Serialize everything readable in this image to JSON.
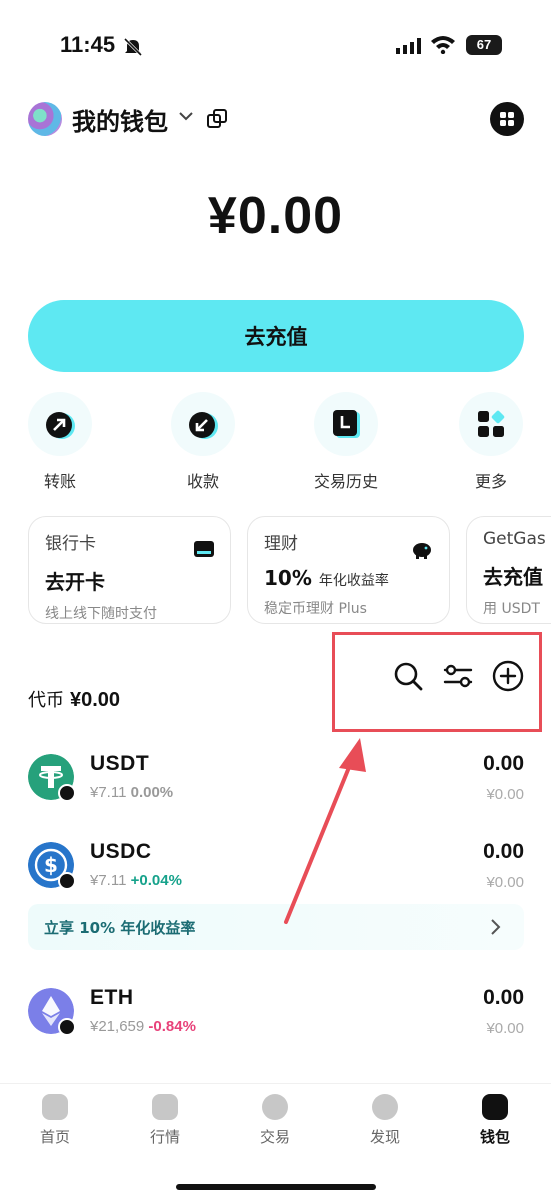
{
  "status_bar": {
    "time": "11:45",
    "battery": "67"
  },
  "header": {
    "wallet_name": "我的钱包"
  },
  "balance": "¥0.00",
  "recharge_label": "去充值",
  "actions": [
    {
      "label": "转账",
      "icon": "send-arrow-icon"
    },
    {
      "label": "收款",
      "icon": "receive-arrow-icon"
    },
    {
      "label": "交易历史",
      "icon": "history-icon"
    },
    {
      "label": "更多",
      "icon": "more-apps-icon"
    }
  ],
  "cards": [
    {
      "title": "银行卡",
      "main": "去开卡",
      "sub": "线上线下随时支付"
    },
    {
      "title": "理财",
      "main": "10%",
      "main_suffix": "年化收益率",
      "sub": "稳定币理财 Plus"
    },
    {
      "title": "GetGas",
      "main": "去充值",
      "sub": "用 USDT"
    }
  ],
  "tokens_header": {
    "label": "代币",
    "amount": "¥0.00"
  },
  "tokens": [
    {
      "symbol": "USDT",
      "price": "¥7.11",
      "change": "0.00%",
      "balance": "0.00",
      "fiat": "¥0.00"
    },
    {
      "symbol": "USDC",
      "price": "¥7.11",
      "change": "+0.04%",
      "balance": "0.00",
      "fiat": "¥0.00"
    },
    {
      "symbol": "ETH",
      "price": "¥21,659",
      "change": "-0.84%",
      "balance": "0.00",
      "fiat": "¥0.00"
    }
  ],
  "promo": {
    "text": "立享 10% 年化收益率"
  },
  "nav": [
    {
      "label": "首页"
    },
    {
      "label": "行情"
    },
    {
      "label": "交易"
    },
    {
      "label": "发现"
    },
    {
      "label": "钱包"
    }
  ],
  "colors": {
    "accent": "#5ee8f2",
    "positive": "#16a28b",
    "negative": "#e8427a",
    "annotation": "#e84d57"
  }
}
